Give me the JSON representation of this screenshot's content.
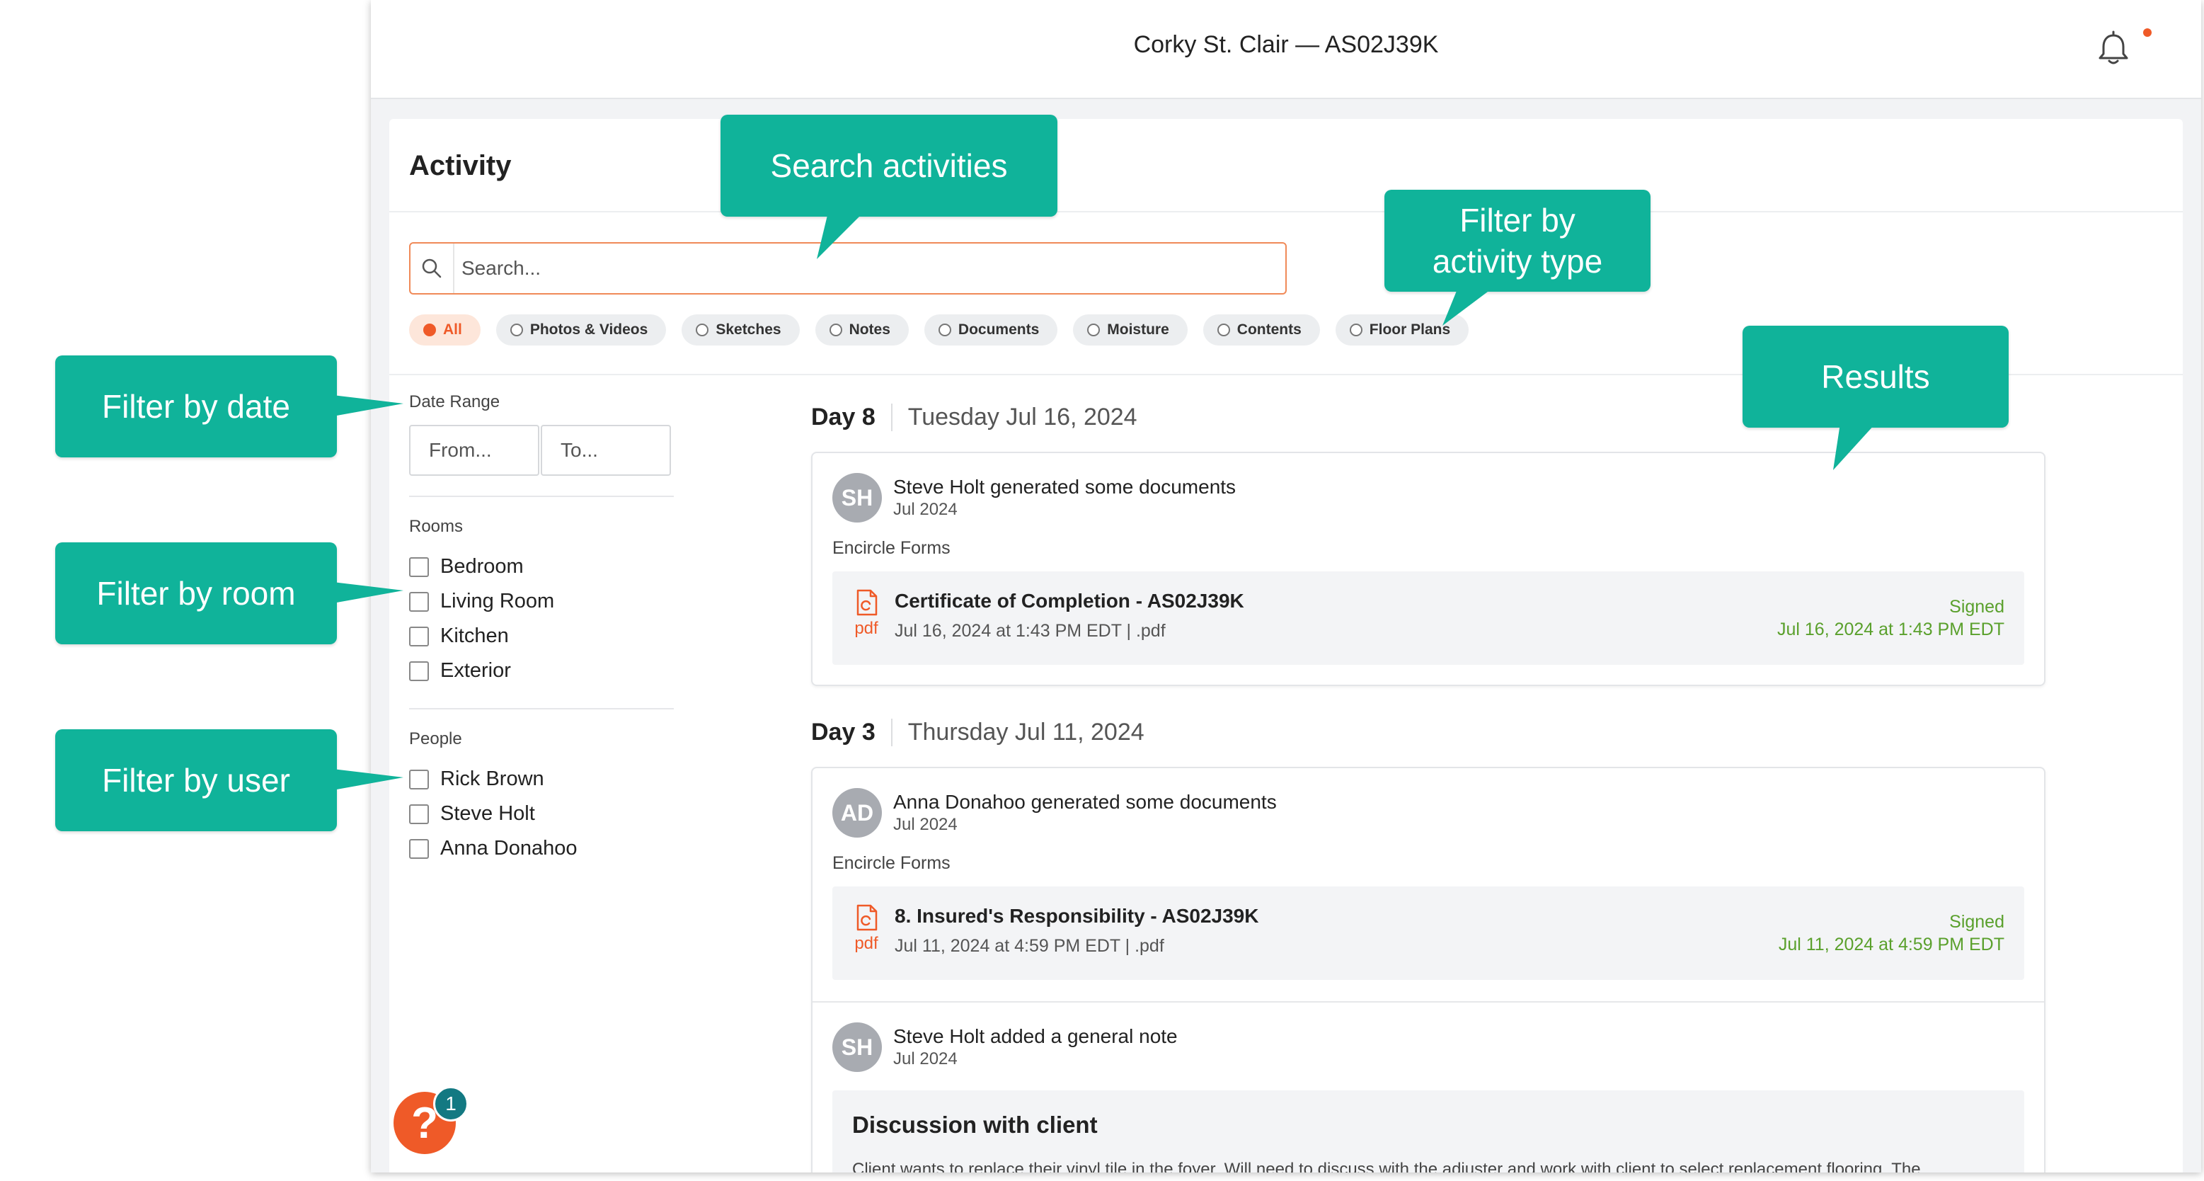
{
  "header": {
    "title": "Corky St. Clair — AS02J39K"
  },
  "activity": {
    "title": "Activity",
    "search": {
      "placeholder": "Search...",
      "value": ""
    },
    "filters": [
      {
        "label": "All",
        "active": true
      },
      {
        "label": "Photos & Videos",
        "active": false
      },
      {
        "label": "Sketches",
        "active": false
      },
      {
        "label": "Notes",
        "active": false
      },
      {
        "label": "Documents",
        "active": false
      },
      {
        "label": "Moisture",
        "active": false
      },
      {
        "label": "Contents",
        "active": false
      },
      {
        "label": "Floor Plans",
        "active": false
      }
    ]
  },
  "sidebar": {
    "date_range_label": "Date Range",
    "from_placeholder": "From...",
    "to_placeholder": "To...",
    "rooms_label": "Rooms",
    "rooms": [
      "Bedroom",
      "Living Room",
      "Kitchen",
      "Exterior"
    ],
    "people_label": "People",
    "people": [
      "Rick Brown",
      "Steve Holt",
      "Anna Donahoo"
    ]
  },
  "days": [
    {
      "day": "Day 8",
      "date": "Tuesday Jul 16, 2024",
      "entries": [
        {
          "initials": "SH",
          "who": "Steve Holt generated some documents",
          "when": "Jul 2024",
          "group": "Encircle Forms",
          "doc": {
            "icon_label": "pdf",
            "title": "Certificate of Completion - AS02J39K",
            "sub": "Jul 16, 2024 at 1:43 PM EDT | .pdf",
            "status": "Signed",
            "status_date": "Jul 16, 2024 at 1:43 PM EDT"
          }
        }
      ]
    },
    {
      "day": "Day 3",
      "date": "Thursday Jul 11, 2024",
      "entries": [
        {
          "initials": "AD",
          "who": "Anna Donahoo generated some documents",
          "when": "Jul 2024",
          "group": "Encircle Forms",
          "doc": {
            "icon_label": "pdf",
            "title": "8. Insured's Responsibility - AS02J39K",
            "sub": "Jul 11, 2024 at 4:59 PM EDT | .pdf",
            "status": "Signed",
            "status_date": "Jul 11, 2024 at 4:59 PM EDT"
          }
        },
        {
          "initials": "SH",
          "who": "Steve Holt added a general note",
          "when": "Jul 2024",
          "note": {
            "title": "Discussion with client",
            "body": "Client wants to replace their vinyl tile in the foyer. Will need to discuss with the adjuster and work with client to select replacement flooring. The"
          }
        }
      ]
    }
  ],
  "help": {
    "icon": "?",
    "badge": "1"
  },
  "callouts": {
    "search": "Search activities",
    "type": [
      "Filter by",
      "activity type"
    ],
    "results": "Results",
    "date": "Filter by date",
    "room": "Filter by room",
    "user": "Filter by user"
  },
  "colors": {
    "accent": "#ef5a28",
    "callout": "#10b39a",
    "signed": "#5aa02c",
    "badge": "#137982"
  }
}
